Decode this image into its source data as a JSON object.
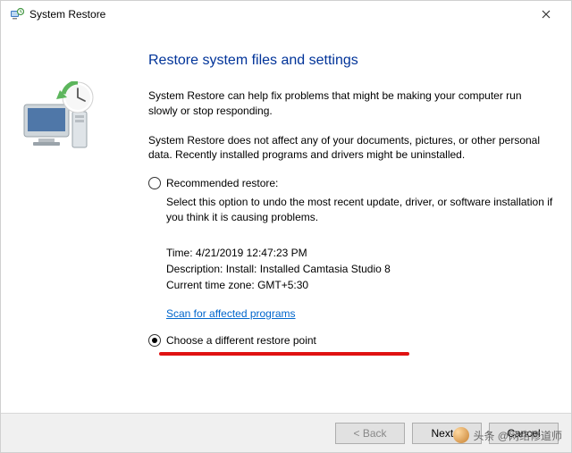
{
  "window": {
    "title": "System Restore"
  },
  "heading": "Restore system files and settings",
  "intro1": "System Restore can help fix problems that might be making your computer run slowly or stop responding.",
  "intro2": "System Restore does not affect any of your documents, pictures, or other personal data. Recently installed programs and drivers might be uninstalled.",
  "option1": {
    "label": "Recommended restore:",
    "desc": "Select this option to undo the most recent update, driver, or software installation if you think it is causing problems.",
    "time_label": "Time:",
    "time_value": "4/21/2019 12:47:23 PM",
    "desc_label": "Description:",
    "desc_value": "Install: Installed Camtasia Studio 8",
    "tz_label": "Current time zone:",
    "tz_value": "GMT+5:30",
    "scan_link": "Scan for affected programs"
  },
  "option2": {
    "label": "Choose a different restore point"
  },
  "buttons": {
    "back": "< Back",
    "next": "Next >",
    "cancel": "Cancel"
  },
  "watermark": "头条 @网络修道师"
}
